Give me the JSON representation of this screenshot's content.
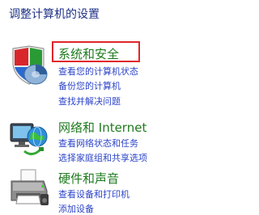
{
  "page": {
    "title": "调整计算机的设置"
  },
  "categories": [
    {
      "title": "系统和安全",
      "icon": "shield-pie-chart-icon",
      "links": [
        "查看您的计算机状态",
        "备份您的计算机",
        "查找并解决问题"
      ]
    },
    {
      "title": "网络和 Internet",
      "icon": "network-globe-icon",
      "links": [
        "查看网络状态和任务",
        "选择家庭组和共享选项"
      ]
    },
    {
      "title": "硬件和声音",
      "icon": "printer-icon",
      "links": [
        "查看设备和打印机",
        "添加设备"
      ]
    }
  ],
  "colors": {
    "title": "#1e3287",
    "category_title": "#1e7b1e",
    "link": "#2c44c8",
    "highlight": "#e0262a"
  }
}
